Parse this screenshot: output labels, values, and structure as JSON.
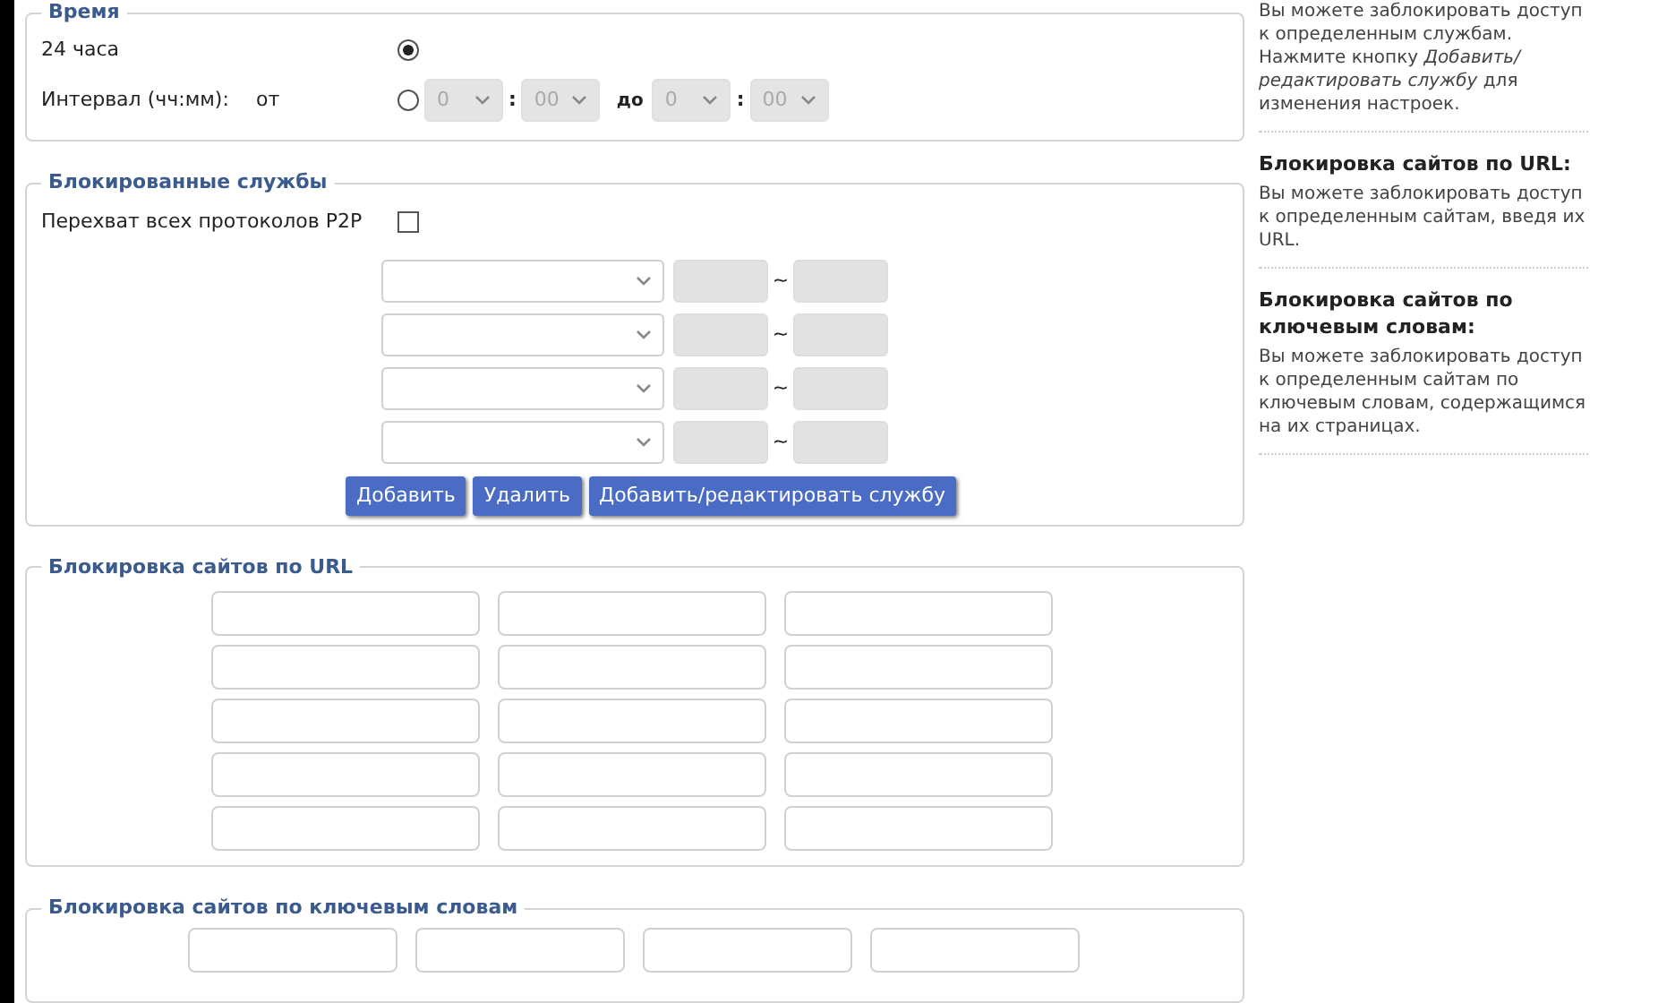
{
  "time": {
    "legend": "Время",
    "options": [
      {
        "kind": "all_day",
        "label": "24 часа",
        "selected": true
      },
      {
        "kind": "interval",
        "label": "Интервал (чч:мм):",
        "from_label": "от",
        "to_label": "до",
        "separator": ":",
        "from": {
          "hour": "0",
          "minute": "00"
        },
        "to": {
          "hour": "0",
          "minute": "00"
        },
        "selected": false,
        "disabled": true
      }
    ]
  },
  "services": {
    "legend": "Блокированные службы",
    "p2p": {
      "label": "Перехват всех протоколов P2P",
      "checked": false
    },
    "rows": [
      {
        "separator": "~",
        "ports_disabled": true
      },
      {
        "separator": "~",
        "ports_disabled": true
      },
      {
        "separator": "~",
        "ports_disabled": true
      },
      {
        "separator": "~",
        "ports_disabled": true
      }
    ],
    "buttons": [
      "Добавить",
      "Удалить",
      "Добавить/редактировать службу"
    ]
  },
  "url_block": {
    "legend": "Блокировка сайтов по URL",
    "rows": [
      {
        "fields": [
          {
            "disabled": false
          },
          {
            "disabled": false
          },
          {
            "disabled": false
          }
        ]
      },
      {
        "fields": [
          {
            "disabled": false
          },
          {
            "disabled": false
          },
          {
            "disabled": false
          }
        ]
      },
      {
        "fields": [
          {
            "disabled": false
          },
          {
            "disabled": false
          },
          {
            "disabled": false
          }
        ]
      },
      {
        "fields": [
          {
            "disabled": false
          },
          {
            "disabled": false
          },
          {
            "disabled": false
          }
        ]
      },
      {
        "fields": [
          {
            "disabled": false
          },
          {
            "disabled": false
          },
          {
            "disabled": false
          }
        ]
      }
    ]
  },
  "keyword_block": {
    "legend": "Блокировка сайтов по ключевым словам",
    "fields": [
      {
        "disabled": false
      },
      {
        "disabled": false
      },
      {
        "disabled": false
      },
      {
        "disabled": false
      }
    ]
  },
  "help": [
    {
      "text": "Вы можете заблокировать доступ к определенным службам. Нажмите кнопку *Добавить/редактировать службу* для изменения настроек."
    },
    {
      "title": "Блокировка сайтов по URL:",
      "text": "Вы можете заблокировать доступ к определенным сайтам, введя их URL."
    },
    {
      "title": "Блокировка сайтов по ключевым словам:",
      "text": "Вы можете заблокировать доступ к определенным сайтам по ключевым словам, содержащимся на их страницах."
    }
  ]
}
